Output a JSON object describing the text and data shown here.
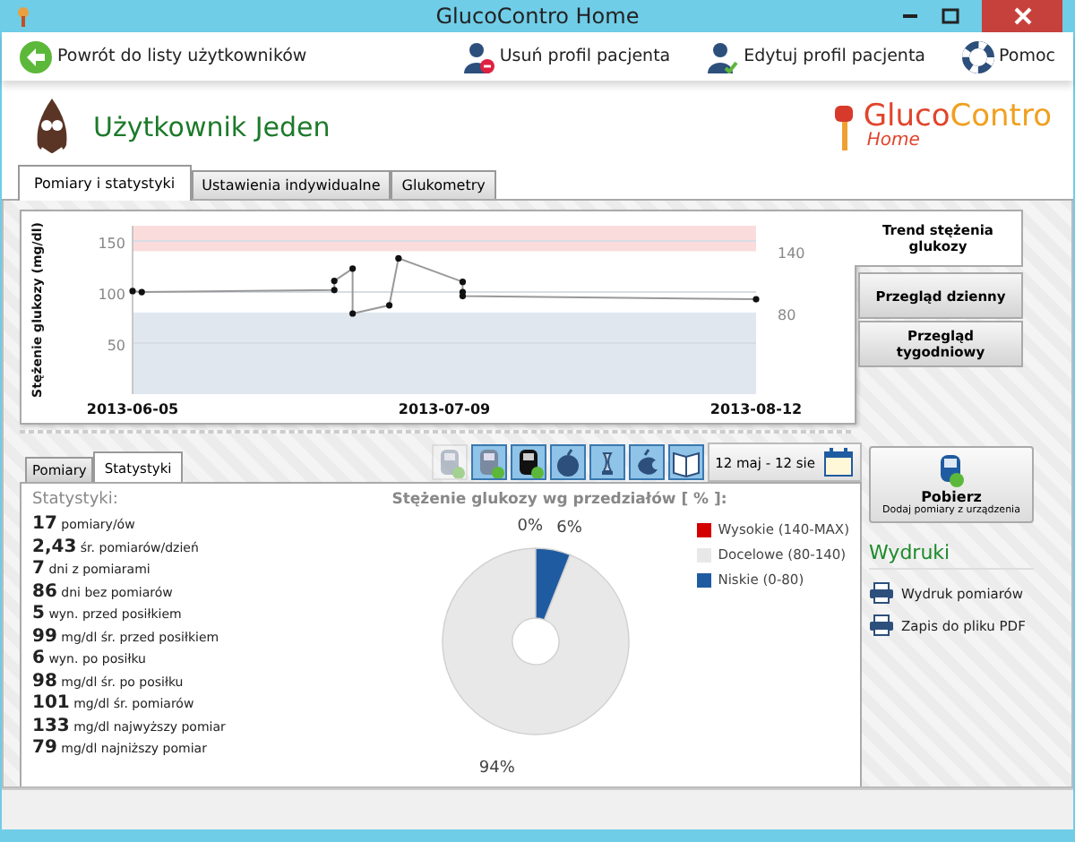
{
  "window": {
    "title": "GlucoContro Home"
  },
  "toolbar": {
    "back": "Powrót do listy użytkowników",
    "actions": [
      {
        "kind": "delete",
        "label": "Usuń profil pacjenta"
      },
      {
        "kind": "edit",
        "label": "Edytuj profil pacjenta"
      },
      {
        "kind": "help",
        "label": "Pomoc"
      }
    ]
  },
  "user": {
    "name": "Użytkownik Jeden"
  },
  "logo": {
    "brand_a": "Gluco",
    "brand_b": "Contro",
    "sub": "Home"
  },
  "tabs": [
    {
      "label": "Pomiary i statystyki",
      "selected": true
    },
    {
      "label": "Ustawienia indywidualne",
      "selected": false
    },
    {
      "label": "Glukometry",
      "selected": false
    }
  ],
  "chart_panel": {
    "views": [
      {
        "label": "Trend stężenia glukozy",
        "selected": true
      },
      {
        "label": "Przegląd dzienny",
        "selected": false
      },
      {
        "label": "Przegląd tygodniowy",
        "selected": false
      }
    ],
    "chart_data": {
      "type": "line",
      "ylabel": "Stężenie glukozy (mg/dl)",
      "x": [
        "2013-06-05",
        "2013-06-06",
        "2013-06-27",
        "2013-06-27",
        "2013-06-29",
        "2013-06-29",
        "2013-07-03",
        "2013-07-04",
        "2013-07-11",
        "2013-07-11",
        "2013-07-11",
        "2013-08-12"
      ],
      "series": [
        {
          "color": "#999999",
          "marker": "circle",
          "values": [
            101,
            100,
            102,
            111,
            123,
            79,
            87,
            133,
            110,
            100,
            96,
            93
          ]
        }
      ],
      "xlim": [
        "2013-06-05",
        "2013-08-12"
      ],
      "ylim": [
        0,
        165
      ],
      "xticks": [
        "2013-06-05",
        "2013-07-09",
        "2013-08-12"
      ],
      "yticks": [
        50,
        100,
        150
      ],
      "grid": true,
      "bands": [
        {
          "axis": "y",
          "from": 140,
          "to": 165,
          "label": "140",
          "color": "#fbdcdc"
        },
        {
          "axis": "y",
          "from": 0,
          "to": 80,
          "label": "80",
          "color": "#e1e7ef"
        }
      ]
    }
  },
  "sub_tabs": [
    {
      "label": "Pomiary",
      "selected": false
    },
    {
      "label": "Statystyki",
      "selected": true
    }
  ],
  "filters": [
    {
      "kind": "meter",
      "on": false
    },
    {
      "kind": "meter",
      "on": true
    },
    {
      "kind": "meter-dark",
      "on": true
    },
    {
      "kind": "apple",
      "on": true
    },
    {
      "kind": "core",
      "on": true
    },
    {
      "kind": "apple-bitten",
      "on": true
    },
    {
      "kind": "book",
      "on": true
    }
  ],
  "date_range": "12 maj - 12 sie",
  "stats": {
    "title": "Statystyki:",
    "items": [
      "**17** pomiary/ów",
      "**2,43** śr. pomiarów/dzień",
      "**7** dni z pomiarami",
      "**86** dni bez pomiarów",
      "**5** wyn. przed posiłkiem",
      "**99** mg/dl śr. przed posiłkiem",
      "**6** wyn. po posiłku",
      "**98** mg/dl śr. po posiłku",
      "**101** mg/dl śr. pomiarów",
      "**133** mg/dl najwyższy pomiar",
      "**79** mg/dl najniższy pomiar"
    ]
  },
  "distribution": {
    "chart_data": {
      "type": "donut",
      "title": "Stężenie glukozy wg przedziałów [ % ]:",
      "values": [
        0,
        94,
        6
      ],
      "value_labels": [
        "0%",
        "94%",
        "6%"
      ]
    },
    "legend": [
      {
        "label": "Wysokie (140-MAX)",
        "color": "#d40000"
      },
      {
        "label": "Docelowe (80-140)",
        "color": "#e8e8e8"
      },
      {
        "label": "Niskie (0-80)",
        "color": "#1f5ba0"
      }
    ]
  },
  "download": {
    "label": "Pobierz",
    "sub": "Dodaj pomiary z urządzenia"
  },
  "prints": {
    "title": "Wydruki",
    "items": [
      "Wydruk pomiarów",
      "Zapis do pliku PDF"
    ]
  }
}
